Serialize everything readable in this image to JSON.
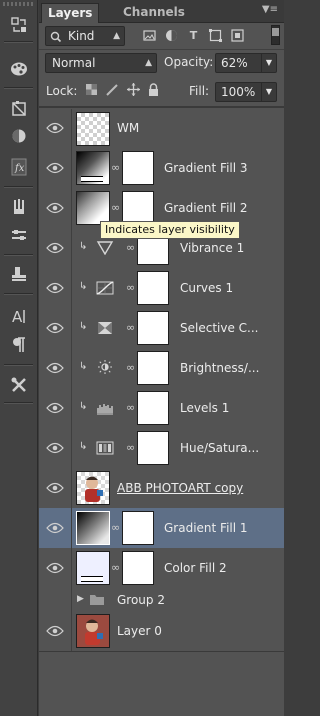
{
  "tabs": [
    {
      "label": "Layers",
      "active": true
    },
    {
      "label": "Channels",
      "active": false
    }
  ],
  "filter": {
    "label": "Kind"
  },
  "blend_mode": {
    "value": "Normal"
  },
  "opacity": {
    "label": "Opacity:",
    "value": "62%"
  },
  "lock": {
    "label": "Lock:"
  },
  "fill": {
    "label": "Fill:",
    "value": "100%"
  },
  "tooltip": "Indicates layer visibility",
  "layers": [
    {
      "name": "WM",
      "kind": "text-raster"
    },
    {
      "name": "Gradient Fill 3",
      "kind": "gradient-fill"
    },
    {
      "name": "Gradient Fill 2",
      "kind": "gradient-fill"
    },
    {
      "name": "Vibrance 1",
      "kind": "adjustment",
      "icon": "vibrance-icon",
      "clipped": true
    },
    {
      "name": "Curves 1",
      "kind": "adjustment",
      "icon": "curves-icon",
      "clipped": true
    },
    {
      "name": "Selective C...",
      "kind": "adjustment",
      "icon": "selective-color-icon",
      "clipped": true
    },
    {
      "name": "Brightness/...",
      "kind": "adjustment",
      "icon": "brightness-icon",
      "clipped": true
    },
    {
      "name": "Levels 1",
      "kind": "adjustment",
      "icon": "levels-icon",
      "clipped": true
    },
    {
      "name": "Hue/Satura...",
      "kind": "adjustment",
      "icon": "hue-saturation-icon",
      "clipped": true
    },
    {
      "name": "ABB PHOTOART copy",
      "kind": "photo"
    },
    {
      "name": "Gradient Fill 1",
      "kind": "gradient-fill",
      "selected": true
    },
    {
      "name": "Color Fill 2",
      "kind": "color-fill"
    },
    {
      "name": "Group 2",
      "kind": "group"
    },
    {
      "name": "Layer 0",
      "kind": "photo"
    }
  ],
  "colors": {
    "panel_bg": "#535353",
    "selected_row": "#5e6f87",
    "tooltip_bg": "#fbf7c8",
    "color_fill_swatch": "#eef0ff"
  }
}
